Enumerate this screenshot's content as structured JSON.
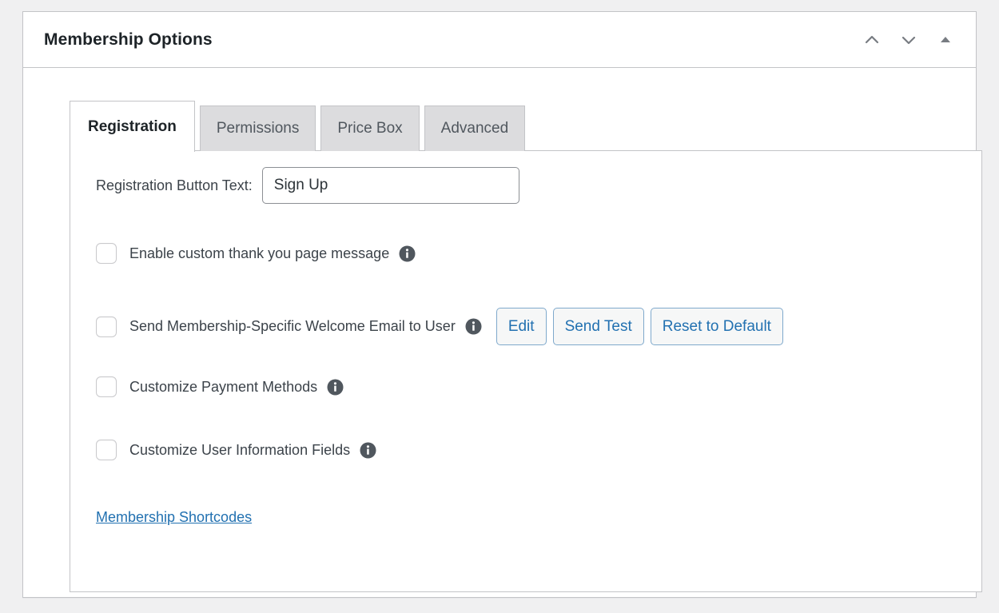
{
  "panel": {
    "title": "Membership Options",
    "header_actions": [
      {
        "name": "move-up",
        "icon": "chevron-up-icon"
      },
      {
        "name": "move-down",
        "icon": "chevron-down-icon"
      },
      {
        "name": "toggle-panel",
        "icon": "triangle-up-icon"
      }
    ]
  },
  "tabs": [
    {
      "label": "Registration",
      "active": true
    },
    {
      "label": "Permissions",
      "active": false
    },
    {
      "label": "Price Box",
      "active": false
    },
    {
      "label": "Advanced",
      "active": false
    }
  ],
  "registration": {
    "button_text_label": "Registration Button Text:",
    "button_text_value": "Sign Up",
    "button_text_placeholder": "",
    "options": [
      {
        "label": "Enable custom thank you page message",
        "checked": false,
        "info_icon": "info-icon"
      },
      {
        "label": "Send Membership-Specific Welcome Email to User",
        "checked": false,
        "info_icon": "info-icon"
      },
      {
        "label": "Customize Payment Methods",
        "checked": false,
        "info_icon": "info-icon"
      },
      {
        "label": "Customize User Information Fields",
        "checked": false,
        "info_icon": "info-icon"
      }
    ],
    "email_buttons": [
      {
        "label": "Edit"
      },
      {
        "label": "Send Test"
      },
      {
        "label": "Reset to Default"
      }
    ],
    "shortcodes_link": "Membership Shortcodes"
  },
  "colors": {
    "page_background": "#f0f0f1",
    "panel_background": "#ffffff",
    "border": "#c3c4c7",
    "title_text": "#1d2327",
    "body_text": "#3c434a",
    "link_blue": "#2271b1",
    "tab_inactive_background": "#dcdcde",
    "icon_gray": "#787c82",
    "info_icon_fill": "#50575e"
  }
}
